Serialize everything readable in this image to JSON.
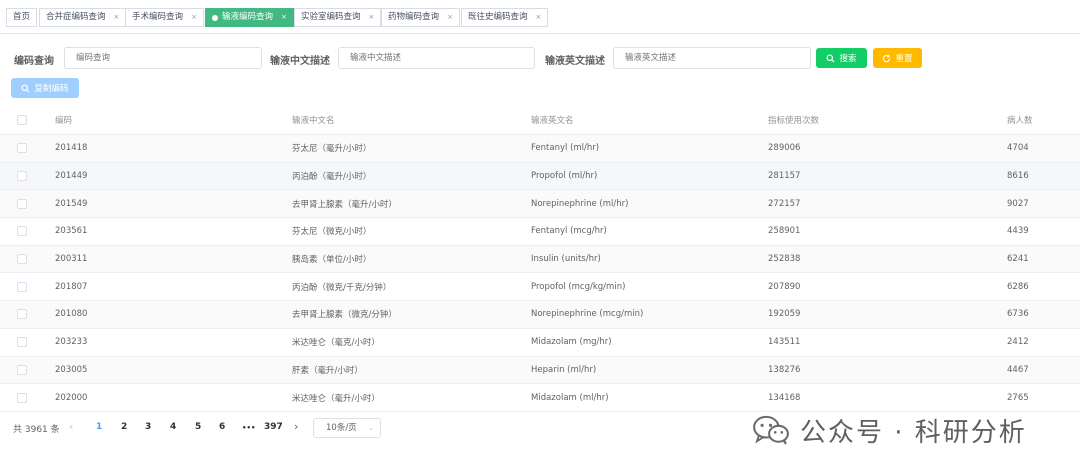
{
  "tabs": [
    {
      "label": "首页",
      "closable": false
    },
    {
      "label": "合并症编码查询",
      "closable": true
    },
    {
      "label": "手术编码查询",
      "closable": true
    },
    {
      "label": "输液编码查询",
      "closable": true,
      "active": true
    },
    {
      "label": "实验室编码查询",
      "closable": true
    },
    {
      "label": "药物编码查询",
      "closable": true
    },
    {
      "label": "既往史编码查询",
      "closable": true
    }
  ],
  "tab_close_glyph": "×",
  "search": {
    "code_label": "编码查询",
    "code_placeholder": "编码查询",
    "cn_label": "输液中文描述",
    "cn_placeholder": "输液中文描述",
    "en_label": "输液英文描述",
    "en_placeholder": "输液英文描述",
    "search_button": "搜索",
    "reset_button": "重置"
  },
  "toolbar": {
    "copy_button": "复制编码"
  },
  "table": {
    "headers": {
      "code": "编码",
      "cn_name": "输液中文名",
      "en_name": "输液英文名",
      "usage": "指标使用次数",
      "patients": "病人数"
    },
    "rows": [
      {
        "code": "201418",
        "cn_name": "芬太尼（毫升/小时）",
        "en_name": "Fentanyl (ml/hr)",
        "usage": "289006",
        "patients": "4704"
      },
      {
        "code": "201449",
        "cn_name": "丙泊酚（毫升/小时）",
        "en_name": "Propofol (ml/hr)",
        "usage": "281157",
        "patients": "8616"
      },
      {
        "code": "201549",
        "cn_name": "去甲肾上腺素（毫升/小时）",
        "en_name": "Norepinephrine (ml/hr)",
        "usage": "272157",
        "patients": "9027"
      },
      {
        "code": "203561",
        "cn_name": "芬太尼（微克/小时）",
        "en_name": "Fentanyl (mcg/hr)",
        "usage": "258901",
        "patients": "4439"
      },
      {
        "code": "200311",
        "cn_name": "胰岛素（单位/小时）",
        "en_name": "Insulin (units/hr)",
        "usage": "252838",
        "patients": "6241"
      },
      {
        "code": "201807",
        "cn_name": "丙泊酚（微克/千克/分钟）",
        "en_name": "Propofol (mcg/kg/min)",
        "usage": "207890",
        "patients": "6286"
      },
      {
        "code": "201080",
        "cn_name": "去甲肾上腺素（微克/分钟）",
        "en_name": "Norepinephrine (mcg/min)",
        "usage": "192059",
        "patients": "6736"
      },
      {
        "code": "203233",
        "cn_name": "米达唑仑（毫克/小时）",
        "en_name": "Midazolam (mg/hr)",
        "usage": "143511",
        "patients": "2412"
      },
      {
        "code": "203005",
        "cn_name": "肝素（毫升/小时）",
        "en_name": "Heparin (ml/hr)",
        "usage": "138276",
        "patients": "4467"
      },
      {
        "code": "202000",
        "cn_name": "米达唑仑（毫升/小时）",
        "en_name": "Midazolam (ml/hr)",
        "usage": "134168",
        "patients": "2765"
      }
    ]
  },
  "pagination": {
    "total_text": "共 3961 条",
    "prev": "‹",
    "next": "›",
    "pages": [
      "1",
      "2",
      "3",
      "4",
      "5",
      "6"
    ],
    "current": "1",
    "ellipsis": "•••",
    "last_page": "397",
    "page_size": "10条/页",
    "caret": "⌄"
  },
  "watermark": {
    "text": "公众号 · 科研分析"
  },
  "colors": {
    "accent_green": "#42b983",
    "search_green": "#13ce66",
    "reset_orange": "#ffba00",
    "copy_blue_light": "#a0cfff",
    "pager_blue": "#409eff"
  }
}
